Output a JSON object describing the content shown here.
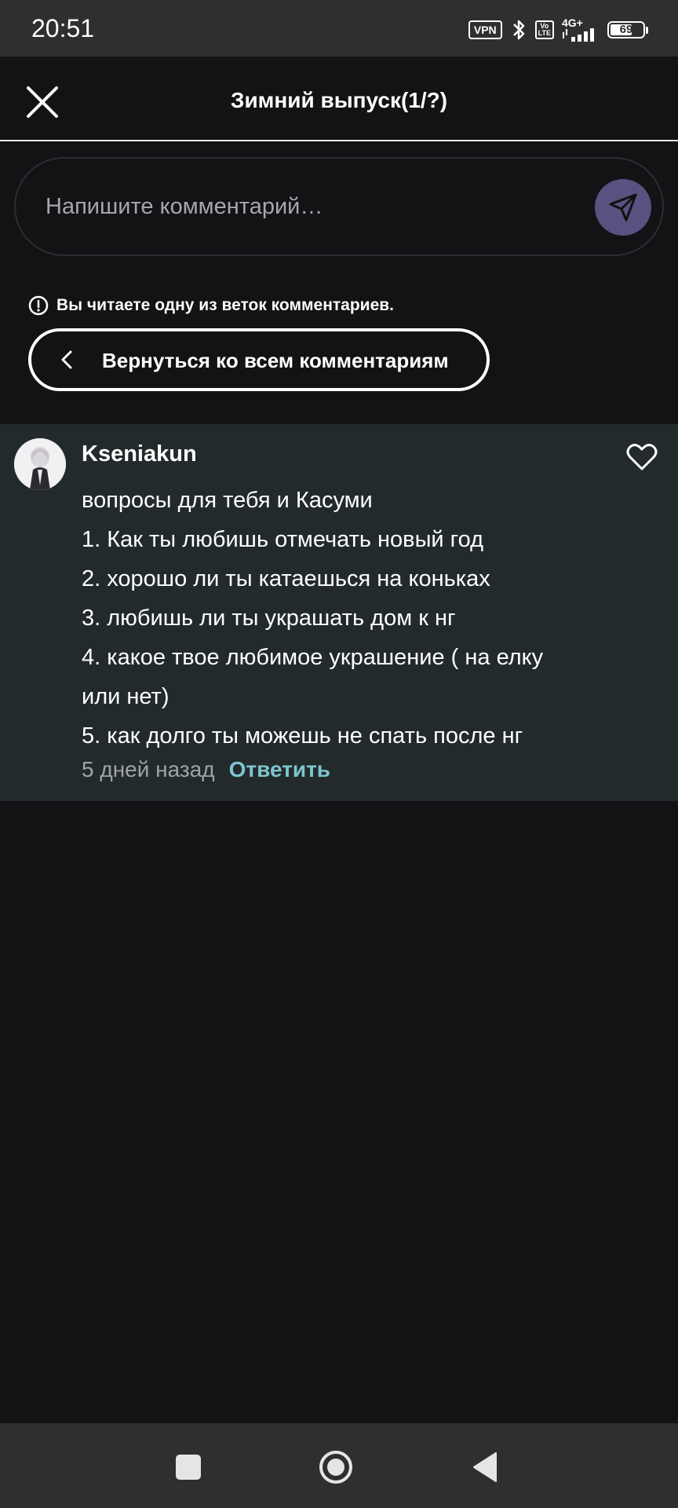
{
  "status_bar": {
    "time": "20:51",
    "vpn_label": "VPN",
    "volte_top": "Vo",
    "volte_bottom": "LTE",
    "network_label": "4G+",
    "battery_level": "69"
  },
  "header": {
    "title": "Зимний выпуск(1/?)",
    "close_icon": "close-icon"
  },
  "comment_input": {
    "placeholder": "Напишите комментарий…",
    "value": "",
    "send_icon": "send-icon",
    "send_color": "#5a5180"
  },
  "thread": {
    "notice": "Вы читаете одну из веток комментариев.",
    "back_label": "Вернуться ко всем комментариям"
  },
  "comment": {
    "author": "Kseniakun",
    "lines": [
      "вопросы для тебя и Касуми",
      "1. Как ты любишь отмечать новый год",
      "2. хорошо ли ты катаешься на коньках",
      "3. любишь ли ты украшать дом к нг",
      "4. какое твое любимое украшение ( на елку",
      "или нет)",
      "5. как долго ты можешь не спать после нг"
    ],
    "time": "5 дней назад",
    "reply_label": "Ответить",
    "reply_color": "#7fc5cf",
    "card_color": "#222a2c"
  },
  "nav_bar": {
    "recents_icon": "square-icon",
    "home_icon": "circle-icon",
    "back_icon": "triangle-back-icon"
  }
}
